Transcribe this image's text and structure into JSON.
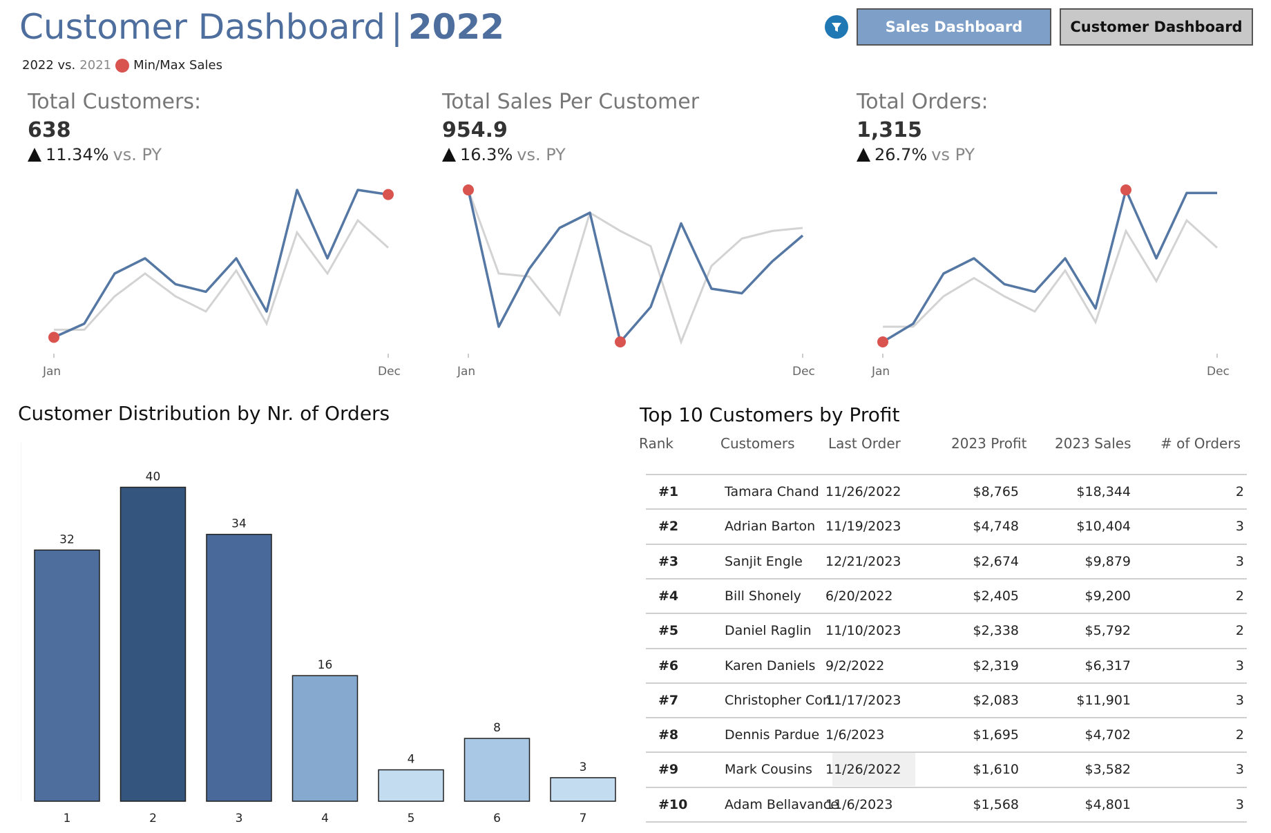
{
  "header": {
    "title_main": "Customer Dashboard",
    "title_sep": "|",
    "title_year": "2022",
    "legend_cy": "2022 vs.",
    "legend_py": "2021",
    "legend_minmax": "Min/Max Sales",
    "filter_icon": "filter-icon",
    "buttons": {
      "sales": "Sales Dashboard",
      "customer": "Customer Dashboard"
    }
  },
  "colors": {
    "accent": "#4e6e9e",
    "current_line": "#5577a3",
    "prior_line": "#d3d3d3",
    "minmax_dot": "#d9534f"
  },
  "kpis": [
    {
      "label": "Total Customers:",
      "value": "638",
      "delta": "11.34%",
      "vs": "vs. PY",
      "direction": "up"
    },
    {
      "label": "Total Sales Per Customer",
      "value": "954.9",
      "delta": "16.3%",
      "vs": "vs. PY",
      "direction": "up"
    },
    {
      "label": "Total Orders:",
      "value": "1,315",
      "delta": "26.7%",
      "vs": "vs PY",
      "direction": "up"
    }
  ],
  "sparklines": {
    "x_start": "Jan",
    "x_end": "Dec",
    "charts": [
      {
        "current": [
          0.03,
          0.12,
          0.45,
          0.55,
          0.38,
          0.33,
          0.55,
          0.2,
          1.0,
          0.55,
          1.0,
          0.97
        ],
        "prior": [
          0.08,
          0.08,
          0.3,
          0.45,
          0.3,
          0.2,
          0.47,
          0.12,
          0.72,
          0.45,
          0.8,
          0.62
        ],
        "min_index": 0,
        "max_index": 11
      },
      {
        "current": [
          1.0,
          0.1,
          0.48,
          0.75,
          0.85,
          0.0,
          0.23,
          0.78,
          0.35,
          0.32,
          0.53,
          0.7
        ],
        "prior": [
          1.0,
          0.45,
          0.43,
          0.18,
          0.85,
          0.73,
          0.63,
          0.0,
          0.5,
          0.68,
          0.73,
          0.75
        ],
        "min_index": 5,
        "max_index": 0
      },
      {
        "current": [
          0.0,
          0.12,
          0.45,
          0.55,
          0.38,
          0.33,
          0.55,
          0.22,
          1.0,
          0.55,
          0.98,
          0.98
        ],
        "prior": [
          0.1,
          0.1,
          0.3,
          0.42,
          0.3,
          0.2,
          0.47,
          0.13,
          0.73,
          0.4,
          0.8,
          0.62
        ],
        "min_index": 0,
        "max_index": 8
      }
    ]
  },
  "distribution": {
    "title": "Customer Distribution by Nr. of Orders",
    "chart_data": {
      "type": "bar",
      "categories": [
        "1",
        "2",
        "3",
        "4",
        "5",
        "6",
        "7"
      ],
      "values": [
        32,
        40,
        34,
        16,
        4,
        8,
        3
      ],
      "ylim": [
        0,
        44
      ],
      "bar_colors": [
        "#4e6e9e",
        "#34557d",
        "#48699a",
        "#86a9cf",
        "#c4dcf0",
        "#a9c8e6",
        "#c4dcf0"
      ]
    }
  },
  "top10": {
    "title": "Top 10 Customers by Profit",
    "columns": [
      "Rank",
      "Customers",
      "Last Order",
      "2023 Profit",
      "2023 Sales",
      "# of Orders"
    ],
    "rows": [
      {
        "rank": "#1",
        "customer": "Tamara Chand",
        "last_order": "11/26/2022",
        "profit": "$8,765",
        "sales": "$18,344",
        "orders": "2"
      },
      {
        "rank": "#2",
        "customer": "Adrian Barton",
        "last_order": "11/19/2023",
        "profit": "$4,748",
        "sales": "$10,404",
        "orders": "3"
      },
      {
        "rank": "#3",
        "customer": "Sanjit Engle",
        "last_order": "12/21/2023",
        "profit": "$2,674",
        "sales": "$9,879",
        "orders": "3"
      },
      {
        "rank": "#4",
        "customer": "Bill Shonely",
        "last_order": "6/20/2022",
        "profit": "$2,405",
        "sales": "$9,200",
        "orders": "2"
      },
      {
        "rank": "#5",
        "customer": "Daniel Raglin",
        "last_order": "11/10/2023",
        "profit": "$2,338",
        "sales": "$5,792",
        "orders": "2"
      },
      {
        "rank": "#6",
        "customer": "Karen Daniels",
        "last_order": "9/2/2022",
        "profit": "$2,319",
        "sales": "$6,317",
        "orders": "3"
      },
      {
        "rank": "#7",
        "customer": "Christopher Con..",
        "last_order": "11/17/2023",
        "profit": "$2,083",
        "sales": "$11,901",
        "orders": "3"
      },
      {
        "rank": "#8",
        "customer": "Dennis Pardue",
        "last_order": "1/6/2023",
        "profit": "$1,695",
        "sales": "$4,702",
        "orders": "2"
      },
      {
        "rank": "#9",
        "customer": "Mark Cousins",
        "last_order": "11/26/2022",
        "profit": "$1,610",
        "sales": "$3,582",
        "orders": "3"
      },
      {
        "rank": "#10",
        "customer": "Adam Bellavance",
        "last_order": "11/6/2023",
        "profit": "$1,568",
        "sales": "$4,801",
        "orders": "3"
      }
    ]
  }
}
